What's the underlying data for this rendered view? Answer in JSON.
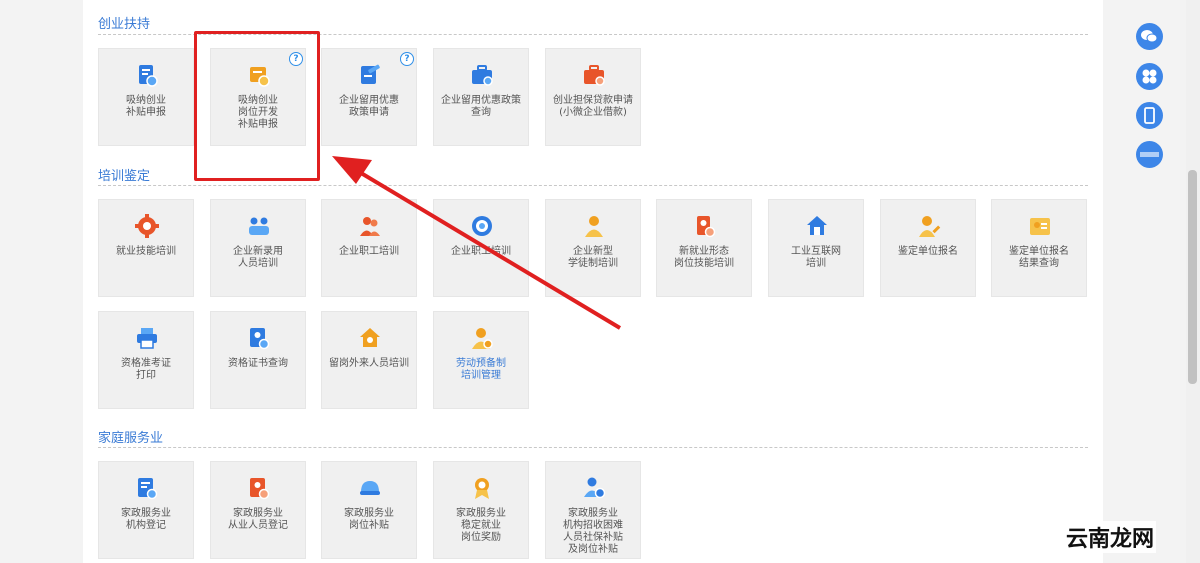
{
  "sections": {
    "s1": "创业扶持",
    "s2": "培训鉴定",
    "s3": "家庭服务业"
  },
  "tiles": {
    "t1": "吸纳创业\n补贴申报",
    "t2": "吸纳创业\n岗位开发\n补贴申报",
    "t3": "企业留用优惠\n政策申请",
    "t4": "企业留用优惠政策\n查询",
    "t5": "创业担保贷款申请\n(小微企业借款)",
    "t6": "就业技能培训",
    "t7": "企业新录用\n人员培训",
    "t8": "企业职工培训",
    "t9": "企业职工培训",
    "t10": "企业新型\n学徒制培训",
    "t11": "新就业形态\n岗位技能培训",
    "t12": "工业互联网\n培训",
    "t13": "鉴定单位报名",
    "t14": "鉴定单位报名\n结果查询",
    "t15": "资格准考证\n打印",
    "t16": "资格证书查询",
    "t17": "留岗外来人员培训",
    "t18": "劳动预备制\n培训管理",
    "t19": "家政服务业\n机构登记",
    "t20": "家政服务业\n从业人员登记",
    "t21": "家政服务业\n岗位补贴",
    "t22": "家政服务业\n稳定就业\n岗位奖励",
    "t23": "家政服务业\n机构招收困难\n人员社保补贴\n及岗位补贴"
  },
  "qmark": "?",
  "watermark": "云南龙网",
  "colors": {
    "accent_blue": "#3a7bd5",
    "icon_blue": "#2f7be0",
    "icon_orange": "#f0a020",
    "icon_red": "#e8552a",
    "highlight_red": "#e02020"
  },
  "icons": {
    "t1": "document-blue-icon",
    "t2": "document-orange-icon",
    "t3": "document-pen-icon",
    "t4": "briefcase-blue-icon",
    "t5": "briefcase-red-icon",
    "t6": "gear-red-icon",
    "t7": "people-blue-icon",
    "t8": "workers-red-icon",
    "t9": "emblem-blue-icon",
    "t10": "person-orange-icon",
    "t11": "phone-doc-red-icon",
    "t12": "house-blue-icon",
    "t13": "person-edit-orange-icon",
    "t14": "id-card-orange-icon",
    "t15": "printer-blue-icon",
    "t16": "certificate-blue-icon",
    "t17": "home-orange-icon",
    "t18": "person-orange-icon",
    "t19": "document-blue-icon",
    "t20": "id-card-red-icon",
    "t21": "cap-blue-icon",
    "t22": "medal-orange-icon",
    "t23": "person-group-blue-icon"
  },
  "sidebar": [
    "wechat-icon",
    "mini-program-icon",
    "mobile-icon",
    "service-badge-icon"
  ]
}
